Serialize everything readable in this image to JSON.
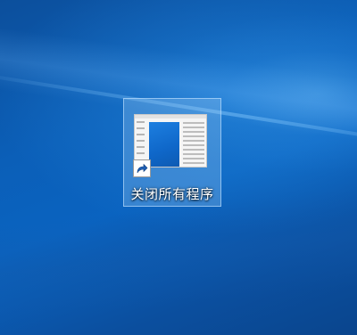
{
  "desktop": {
    "icons": [
      {
        "label": "关闭所有程序",
        "type": "shortcut",
        "icon": "window-thumbnail-icon",
        "badge": "shortcut-arrow-icon",
        "selected": true
      }
    ]
  },
  "colors": {
    "wallpaper": "#0b5fb8",
    "selection": "#a0cdf5",
    "label_text": "#ffffff"
  }
}
